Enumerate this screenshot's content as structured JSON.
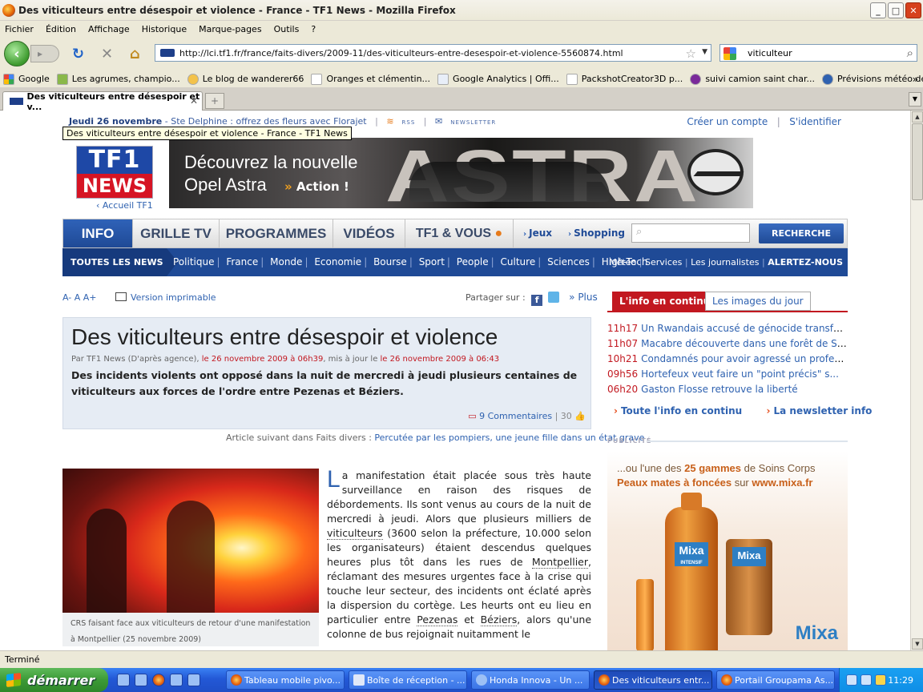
{
  "window": {
    "title": "Des viticulteurs entre désespoir et violence - France - TF1 News - Mozilla Firefox"
  },
  "menu": [
    "Fichier",
    "Édition",
    "Affichage",
    "Historique",
    "Marque-pages",
    "Outils",
    "?"
  ],
  "nav": {
    "url": "http://lci.tf1.fr/france/faits-divers/2009-11/des-viticulteurs-entre-desespoir-et-violence-5560874.html",
    "search_value": "viticulteur"
  },
  "bookmarks": [
    "Google",
    "Les agrumes, champio...",
    "Le blog de wanderer66",
    "Oranges et clémentin...",
    "Google Analytics | Offi...",
    "PackshotCreator3D p...",
    "suivi camion saint char...",
    "Prévisions météo de M..."
  ],
  "tab": {
    "title": "Des viticulteurs entre désespoir et v..."
  },
  "page": {
    "date": "Jeudi 26 novembre",
    "saint": " - Ste Delphine : offrez des fleurs avec Florajet",
    "rss": "RSS",
    "newsletter": "NEWSLETTER",
    "create_account": "Créer un compte",
    "login": "S'identifier",
    "tooltip": "Des viticulteurs entre désespoir et violence - France - TF1 News",
    "logo_top": "TF1",
    "logo_bottom": "NEWS",
    "accueil": "Accueil TF1",
    "banner": {
      "line1": "Découvrez la nouvelle",
      "line2": "Opel Astra",
      "action": "Action !",
      "brand": "ASTRA"
    },
    "mainnav": [
      "INFO",
      "GRILLE TV",
      "PROGRAMMES",
      "VIDÉOS",
      "TF1 & VOUS"
    ],
    "jeux": "Jeux",
    "shopping": "Shopping",
    "search_button": "RECHERCHE NEWS",
    "subnav_title": "TOUTES LES NEWS",
    "categories": [
      "Politique",
      "France",
      "Monde",
      "Economie",
      "Bourse",
      "Sport",
      "People",
      "Culture",
      "Sciences",
      "High-Tech"
    ],
    "subnav_right": [
      "Météo",
      "Services",
      "Les journalistes",
      "ALERTEZ-NOUS"
    ],
    "font_sizes": "A- A A+",
    "print": "Version imprimable",
    "share_label": "Partager sur :",
    "share_more": "» Plus",
    "article": {
      "title": "Des viticulteurs entre désespoir et violence",
      "by": "Par TF1 News (D'après agence), ",
      "date1": "le 26 novembre 2009 à 06h39",
      "mid": ", mis à jour le ",
      "date2": "le 26 novembre 2009 à 06:43",
      "lede": "Des incidents violents ont opposé dans la nuit de mercredi à jeudi plusieurs centaines de viticulteurs aux forces de l'ordre entre Pezenas et Béziers.",
      "comments": "9 Commentaires",
      "likes": "30",
      "next_label": "Article suivant dans Faits divers : ",
      "next_link": "Percutée par les pompiers, une jeune fille dans un état grave",
      "caption": "CRS faisant face aux viticulteurs de retour d'une manifestation à Montpellier (25 novembre 2009)",
      "dropcap": "L",
      "p1": "a manifestation était placée sous très haute surveillance en raison des risques de débordements. Ils sont venus au cours de la nuit de mercredi à jeudi. Alors que plusieurs milliers de ",
      "w1": "viticulteurs",
      "p2": " (3600 selon la préfecture, 10.000 selon les organisateurs) étaient descendus quelques heures plus tôt dans les rues de ",
      "w2": "Montpellier",
      "p3": ", réclamant des mesures urgentes face à la crise qui touche leur secteur, des incidents ont éclaté après la dispersion du cortège. Les heurts ont eu lieu en particulier entre ",
      "w3": "Pezenas",
      "p4": " et ",
      "w4": "Béziers",
      "p5": ", alors qu'une colonne de bus rejoignait nuitamment le"
    },
    "right": {
      "tab_on": "L'info en continu",
      "tab_off": "Les images du jour",
      "news": [
        {
          "time": "11h17",
          "text": "Un Rwandais accusé de génocide transféré..."
        },
        {
          "time": "11h07",
          "text": "Macabre découverte dans une forêt de Sei..."
        },
        {
          "time": "10h21",
          "text": "Condamnés pour avoir agressé un professe..."
        },
        {
          "time": "09h56",
          "text": "Hortefeux veut faire un \"point précis\" s..."
        },
        {
          "time": "06h20",
          "text": "Gaston Flosse retrouve la liberté"
        }
      ],
      "all_news": "Toute l'info en continu",
      "newsletter": "La newsletter info",
      "pub": "PUBLICITÉ",
      "ad_l1a": "...ou l'une des ",
      "ad_l1b": "25 gammes",
      "ad_l1c": " de Soins Corps",
      "ad_l2a": "Peaux mates à foncées",
      "ad_l2b": " sur ",
      "ad_l2c": "www.mixa.fr",
      "ad_brand": "Mixa",
      "ad_product": "INTENSIF"
    }
  },
  "status": "Terminé",
  "taskbar": {
    "start": "démarrer",
    "items": [
      "Tableau mobile pivo...",
      "Boîte de réception - ...",
      "Honda Innova - Un ...",
      "Des viticulteurs entr...",
      "Portail Groupama As..."
    ],
    "clock": "11:29"
  }
}
